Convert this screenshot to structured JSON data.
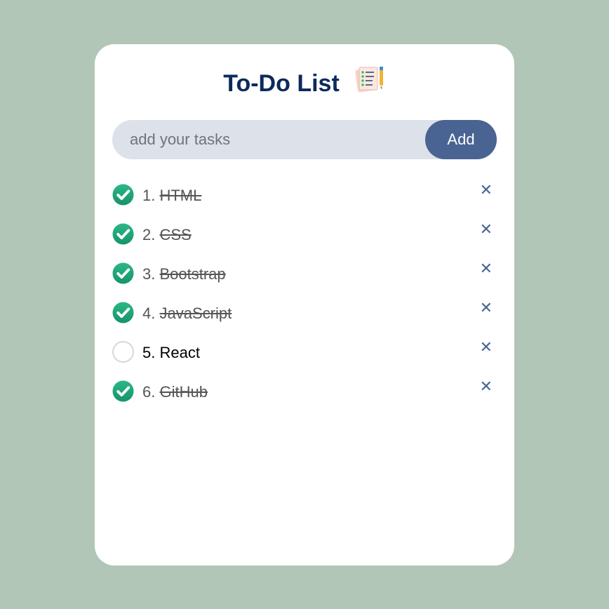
{
  "app": {
    "title": "To-Do List",
    "title_icon": "checklist-notepad-pencil-icon"
  },
  "input": {
    "placeholder": "add your tasks",
    "value": "",
    "add_label": "Add"
  },
  "colors": {
    "background": "#b1c6b7",
    "title": "#0c2a5c",
    "accent": "#496493",
    "input_bg": "#dde1e9",
    "check": "#1fa37a"
  },
  "tasks": [
    {
      "number": "1.",
      "text": "HTML",
      "done": true
    },
    {
      "number": "2.",
      "text": "CSS",
      "done": true
    },
    {
      "number": "3.",
      "text": "Bootstrap",
      "done": true
    },
    {
      "number": "4.",
      "text": "JavaScript",
      "done": true
    },
    {
      "number": "5.",
      "text": "React",
      "done": false
    },
    {
      "number": "6.",
      "text": "GitHub",
      "done": true
    }
  ],
  "delete_symbol": "✕"
}
